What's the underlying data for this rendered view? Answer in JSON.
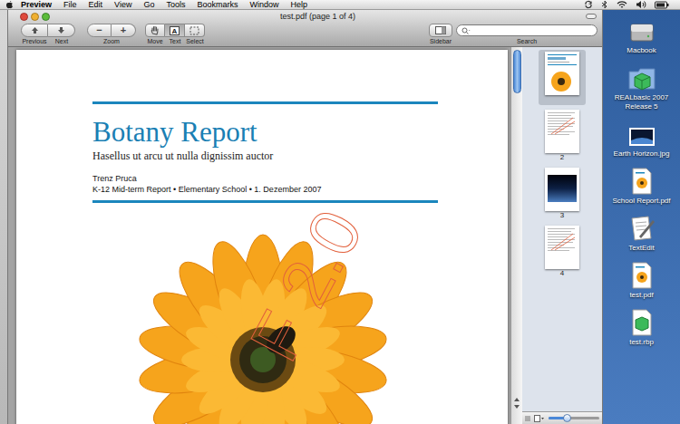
{
  "menu_bar": {
    "app": "Preview",
    "items": [
      "File",
      "Edit",
      "View",
      "Go",
      "Tools",
      "Bookmarks",
      "Window",
      "Help"
    ]
  },
  "window": {
    "title": "test.pdf (page 1 of 4)"
  },
  "toolbar": {
    "navigation": [
      {
        "label": "Previous",
        "kind": "up"
      },
      {
        "label": "Next",
        "kind": "down"
      }
    ],
    "zoom": {
      "label": "Zoom",
      "buttons": [
        "−",
        "+"
      ]
    },
    "tools": [
      {
        "label": "Move",
        "kind": "hand",
        "glyph": "",
        "selected": false
      },
      {
        "label": "Text",
        "kind": "text",
        "glyph": "A",
        "selected": true
      },
      {
        "label": "Select",
        "kind": "marquee",
        "glyph": "",
        "selected": false
      }
    ],
    "sidebar_button": {
      "label": "Sidebar"
    },
    "search": {
      "label": "Search"
    }
  },
  "document": {
    "title": "Botany Report",
    "subtitle": "Hasellus ut arcu ut nulla dignissim auctor",
    "author": "Trenz Pruca",
    "details": "K-12 Mid-term Report • Elementary School • 1. Dezember 2007",
    "watermark": "F 2.0"
  },
  "thumbnails": [
    {
      "label": "",
      "kind": "flower",
      "selected": true
    },
    {
      "label": "2",
      "kind": "text",
      "selected": false
    },
    {
      "label": "3",
      "kind": "photo",
      "selected": false
    },
    {
      "label": "4",
      "kind": "text",
      "selected": false
    }
  ],
  "thumbnail_size": {
    "level": 0.35
  },
  "desktop_icons": [
    {
      "label": "Macbook",
      "kind": "drive"
    },
    {
      "label": "REALbasic 2007 Release 5",
      "kind": "folder"
    },
    {
      "label": "Earth Horizon.jpg",
      "kind": "image"
    },
    {
      "label": "School Report.pdf",
      "kind": "pdf"
    },
    {
      "label": "TextEdit",
      "kind": "app"
    },
    {
      "label": "test.pdf",
      "kind": "pdf"
    },
    {
      "label": "test.rbp",
      "kind": "file"
    }
  ]
}
